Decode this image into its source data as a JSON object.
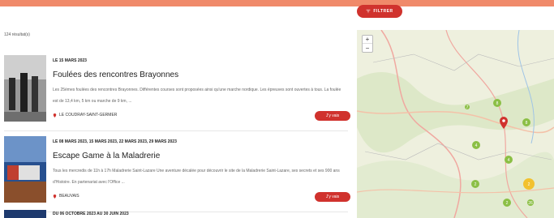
{
  "toolbar": {
    "filter_label": "FILTRER"
  },
  "results": {
    "count_label": "124 résultat(s)"
  },
  "events": [
    {
      "date": "LE 15 MARS 2023",
      "title": "Foulées des rencontres Brayonnes",
      "description": "Les 25èmes foulées des rencontres Brayonnes. Différentes courses sont proposées ainsi qu'une marche nordique. Les épreuves sont ouvertes à tous. La foulée est de 13,4 km, 5 km ou marche de 9 km, ...",
      "place": "LE COUDRAY-SAINT-GERMER",
      "button": "J'y vais"
    },
    {
      "date": "LE 08 MARS 2023, 15 MARS 2023, 22 MARS 2023, 29 MARS 2023",
      "title": "Escape Game à la Maladrerie",
      "description": "Tous les mercredis de 11h à 17h Maladrerie Saint-Lazare Une aventure décalée pour découvrir le site de la Maladrerie Saint-Lazare, ses secrets et ses 900 ans d'Histoire. En partenariat avec l'Office ...",
      "place": "BEAUVAIS",
      "button": "J'y vais"
    },
    {
      "date": "DU 06 OCTOBRE 2023 AU 30 JUIN 2023"
    }
  ],
  "map": {
    "zoom_in": "+",
    "zoom_out": "−",
    "clusters": [
      "7",
      "8",
      "8",
      "4",
      "4",
      "2",
      "2",
      "2",
      "26"
    ]
  },
  "colors": {
    "accent": "#d0322d",
    "background": "#f08a6a",
    "cluster_green": "#8bbf45",
    "cluster_yellow": "#f2c12e"
  }
}
